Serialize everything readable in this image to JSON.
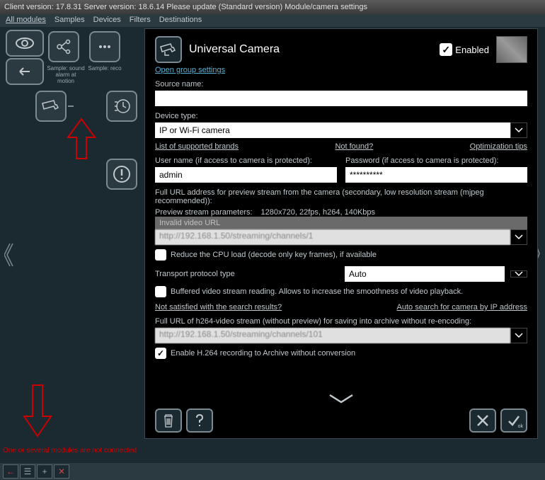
{
  "titlebar": "Client version: 17.8.31 Server version: 18.6.14 Please update (Standard version) Module/camera settings",
  "menu": {
    "all": "All modules",
    "samples": "Samples",
    "devices": "Devices",
    "filters": "Filters",
    "destinations": "Destinations"
  },
  "toolbar": {
    "label1": "Sample: sound alarm at motion",
    "label2": "Sample: reco"
  },
  "dialog": {
    "title": "Universal Camera",
    "enabled_label": "Enabled",
    "open_group": "Open group settings",
    "source_name_label": "Source name:",
    "source_name_value": "",
    "device_type_label": "Device type:",
    "device_type_value": "IP or Wi-Fi camera",
    "link_brands": "List of supported brands",
    "link_notfound": "Not found?",
    "link_opttips": "Optimization tips",
    "username_label": "User name (if access to camera is protected):",
    "username_value": "admin",
    "password_label": "Password (if access to camera is protected):",
    "password_value": "**********",
    "fullurl_label": "Full URL address for preview stream from the camera (secondary, low resolution stream (mjpeg recommended)):",
    "preview_params_label": "Preview stream parameters:",
    "preview_params_value": "1280x720, 22fps, h264, 140Kbps",
    "invalid_url": "Invalid video URL",
    "url1_blur": "http://192.168.1.50/streaming/channels/1",
    "reduce_cpu": "Reduce the CPU load (decode only key frames), if available",
    "transport_label": "Transport protocol type",
    "transport_value": "Auto",
    "buffered": "Buffered video stream reading. Allows to increase the smoothness of video playback.",
    "link_notsatisfied": "Not satisfied with the search results?",
    "link_autosearch": "Auto search for camera by IP address",
    "h264_label": "Full URL of h264-video stream (without preview) for saving into archive without re-encoding:",
    "url2_blur": "http://192.168.1.50/streaming/channels/101",
    "enable_h264": "Enable H.264 recording to Archive without conversion",
    "ok_sub": "ok"
  },
  "error_msg": "One or several modules are not connected"
}
